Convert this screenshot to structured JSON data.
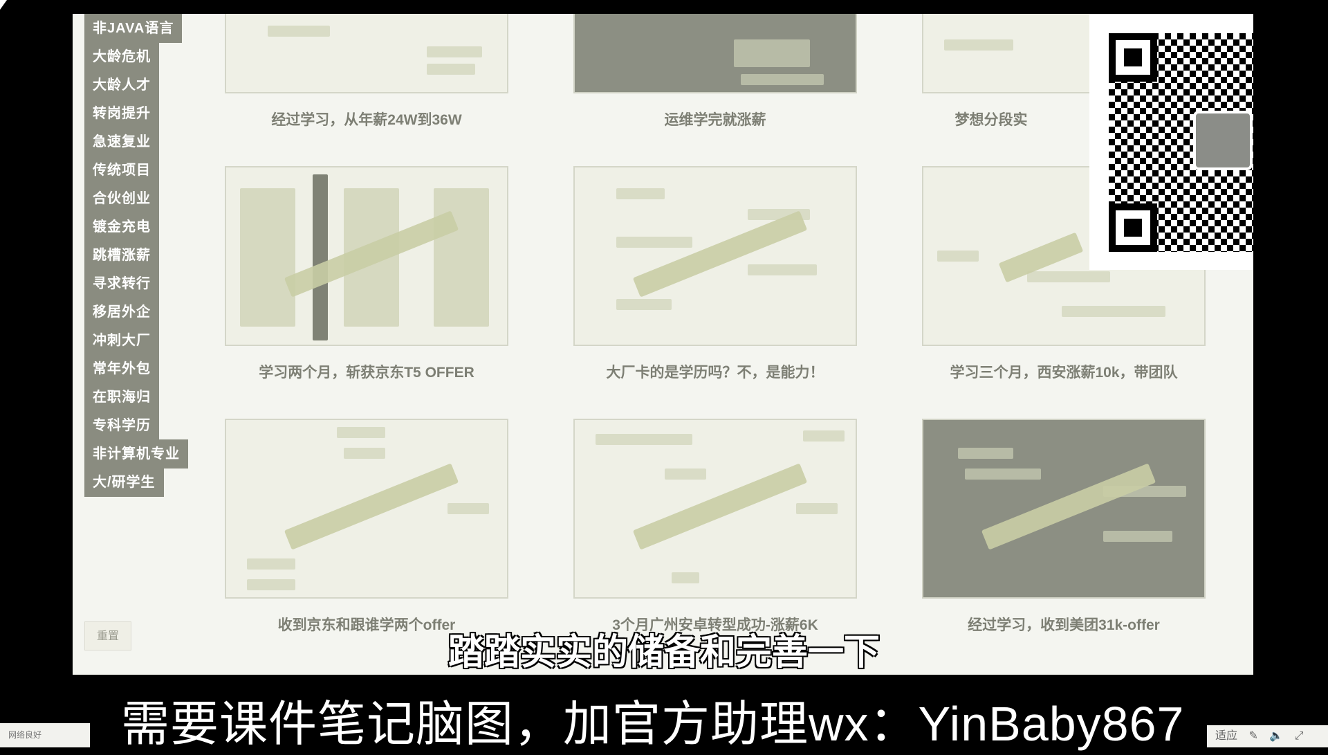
{
  "sidebar": {
    "tags": [
      "非JAVA语言",
      "大龄危机",
      "大龄人才",
      "转岗提升",
      "急速复业",
      "传统项目",
      "合伙创业",
      "镀金充电",
      "跳槽涨薪",
      "寻求转行",
      "移居外企",
      "冲刺大厂",
      "常年外包",
      "在职海归",
      "专科学历",
      "非计算机专业",
      "大/研学生"
    ],
    "reset_label": "重置"
  },
  "cards": [
    {
      "caption": "经过学习，从年薪24W到36W"
    },
    {
      "caption": "运维学完就涨薪"
    },
    {
      "caption": "梦想分段实"
    },
    {
      "caption": "学习两个月，斩获京东T5 OFFER"
    },
    {
      "caption": "大厂卡的是学历吗？不，是能力！"
    },
    {
      "caption": "学习三个月，西安涨薪10k，带团队"
    },
    {
      "caption": "收到京东和跟谁学两个offer"
    },
    {
      "caption": "3个月广州安卓转型成功-涨薪6K"
    },
    {
      "caption": "经过学习，收到美团31k-offer"
    }
  ],
  "subtitle_main": "踏踏实实的储备和完善一下",
  "subtitle_ad": "需要课件笔记脑图，加官方助理wx：YinBaby867",
  "status": {
    "left_text": "网络良好",
    "right_text": "适应"
  }
}
